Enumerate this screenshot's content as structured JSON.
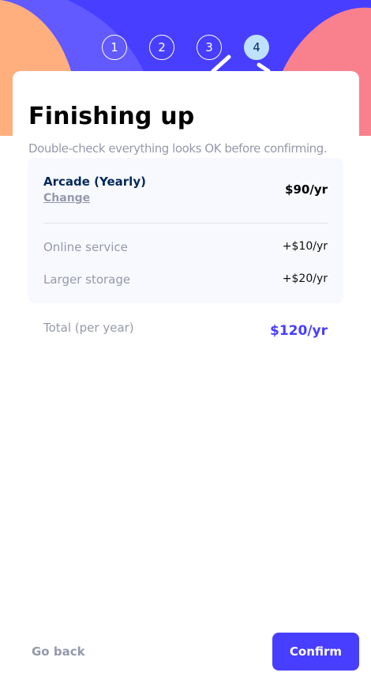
{
  "steps": [
    {
      "number": "1",
      "active": false
    },
    {
      "number": "2",
      "active": false
    },
    {
      "number": "3",
      "active": false
    },
    {
      "number": "4",
      "active": true
    }
  ],
  "page": {
    "title": "Finishing up",
    "subtitle": "Double-check everything looks OK before confirming."
  },
  "summary": {
    "plan_name": "Arcade (Yearly)",
    "plan_change": "Change",
    "plan_price": "$90/yr",
    "addons": [
      {
        "name": "Online service",
        "price": "+$10/yr"
      },
      {
        "name": "Larger storage",
        "price": "+$20/yr"
      }
    ]
  },
  "total": {
    "label": "Total (per year)",
    "price": "$120/yr"
  },
  "footer": {
    "back_label": "Go back",
    "confirm_label": "Confirm"
  },
  "colors": {
    "accent": "#483eff",
    "marine_blue": "#02295a",
    "cool_gray": "#9699ab",
    "magnolia": "#f8f9fe",
    "light_blue": "#bee2fd",
    "pastel_orange": "#ffaf7e",
    "light_red": "#f9818e"
  }
}
